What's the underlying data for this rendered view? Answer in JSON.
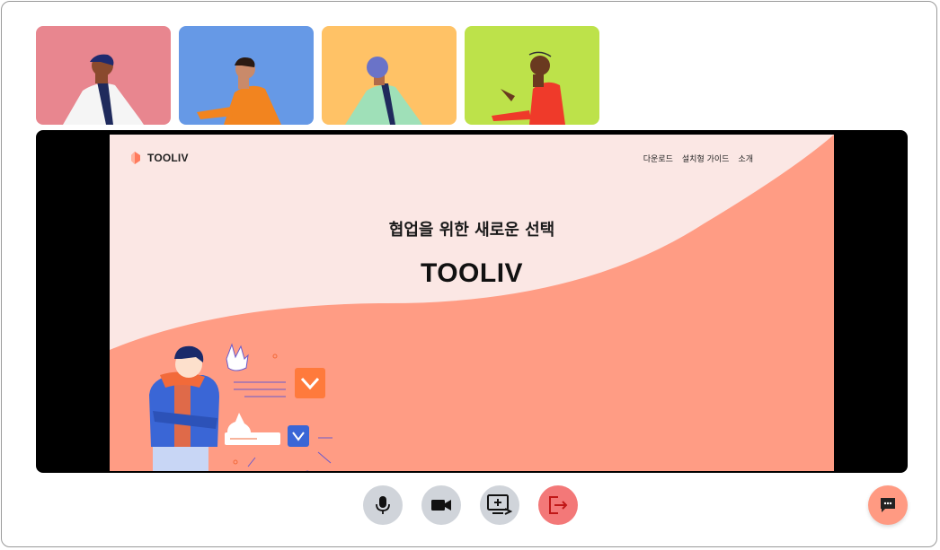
{
  "participants": [
    {
      "name": "participant-1",
      "bg": "#e8868f"
    },
    {
      "name": "participant-2",
      "bg": "#6699e6"
    },
    {
      "name": "participant-3",
      "bg": "#ffc266"
    },
    {
      "name": "participant-4",
      "bg": "#bde24a"
    }
  ],
  "shared_screen": {
    "logo_text": "TOOLIV",
    "nav": [
      "다운로드",
      "설치형 가이드",
      "소개"
    ],
    "hero_subtitle": "협업을 위한 새로운 선택",
    "hero_title": "TOOLIV",
    "accent_color": "#ff9c84"
  },
  "controls": {
    "mic_icon": "microphone-icon",
    "camera_icon": "video-camera-icon",
    "share_icon": "screen-share-icon",
    "leave_icon": "exit-icon",
    "chat_icon": "chat-bubble-icon"
  },
  "colors": {
    "control_bg": "#d0d4da",
    "leave_bg": "#f37878",
    "chat_bg": "#ff9a82"
  }
}
